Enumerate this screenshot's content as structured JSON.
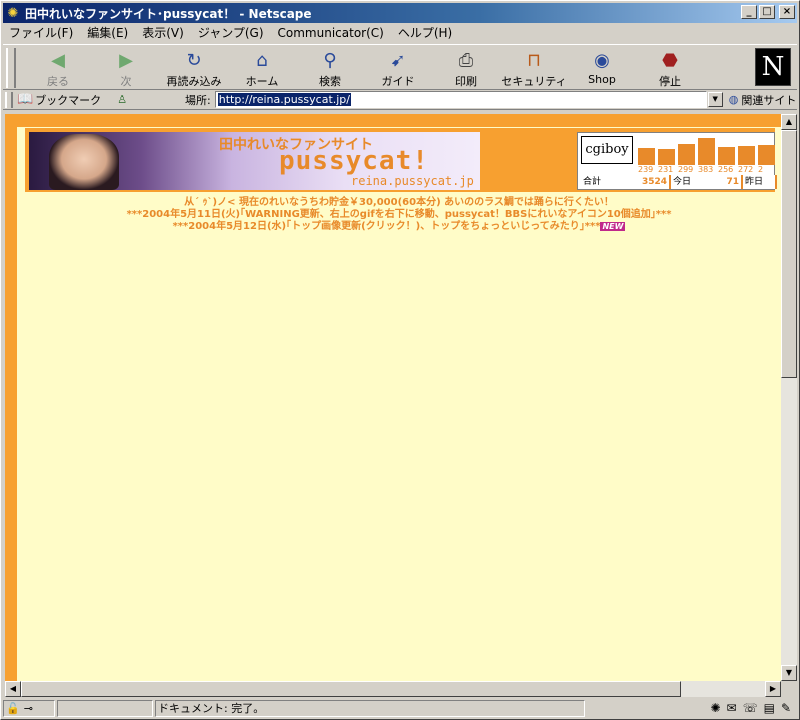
{
  "window": {
    "title": "田中れいなファンサイト･pussycat！ - Netscape",
    "min": "_",
    "max": "□",
    "close": "×"
  },
  "menu": [
    "ファイル(F)",
    "編集(E)",
    "表示(V)",
    "ジャンプ(G)",
    "Communicator(C)",
    "ヘルプ(H)"
  ],
  "toolbar": [
    {
      "label": "戻る",
      "icon": "back-icon",
      "glyph": "◆",
      "disabled": true
    },
    {
      "label": "次",
      "icon": "forward-icon",
      "glyph": "◆",
      "disabled": true
    },
    {
      "label": "再読み込み",
      "icon": "reload-icon",
      "glyph": "↻"
    },
    {
      "label": "ホーム",
      "icon": "home-icon",
      "glyph": "⌂"
    },
    {
      "label": "検索",
      "icon": "search-icon",
      "glyph": "⚲"
    },
    {
      "label": "ガイド",
      "icon": "guide-icon",
      "glyph": "➹"
    },
    {
      "label": "印刷",
      "icon": "print-icon",
      "glyph": "⎙"
    },
    {
      "label": "セキュリティ",
      "icon": "lock-icon",
      "glyph": "🔒"
    },
    {
      "label": "Shop",
      "icon": "shop-icon",
      "glyph": "◉"
    },
    {
      "label": "停止",
      "icon": "stop-icon",
      "glyph": "⬣"
    }
  ],
  "logo": "N",
  "location": {
    "bookmarks": "ブックマーク",
    "label": "場所:",
    "url": "http://reina.pussycat.jp/",
    "related": "関連サイト"
  },
  "banner": {
    "line1": "田中れいなファンサイト",
    "line2": "pussycat!",
    "line3": "reina.pussycat.jp"
  },
  "counter": {
    "logo": "cgiboy",
    "bars": [
      {
        "label": "239",
        "value": 239
      },
      {
        "label": "231",
        "value": 231
      },
      {
        "label": "299",
        "value": 299
      },
      {
        "label": "383",
        "value": 383
      },
      {
        "label": "256",
        "value": 256
      },
      {
        "label": "272",
        "value": 272
      },
      {
        "label": "2",
        "value": 285
      }
    ],
    "total_label": "合計",
    "total": "3524",
    "today_label": "今日",
    "today": "71",
    "yesterday_label": "昨日"
  },
  "news": [
    "从´ ｩ`)ノ< 現在のれいなうちわ貯金￥30,000(60本分) あいののラス鯛では踊らに行くたい！",
    "***2004年5月11日(火)｢WARNING更新、右上のgifを右下に移動、pussycat！BBSにれいなアイコン10個追加｣***",
    "***2004年5月12日(水)｢トップ画像更新(クリック！)、トップをちょっといじってみたり｣***"
  ],
  "new_badge": "NEW",
  "status": {
    "text": "ドキュメント: 完了。"
  }
}
